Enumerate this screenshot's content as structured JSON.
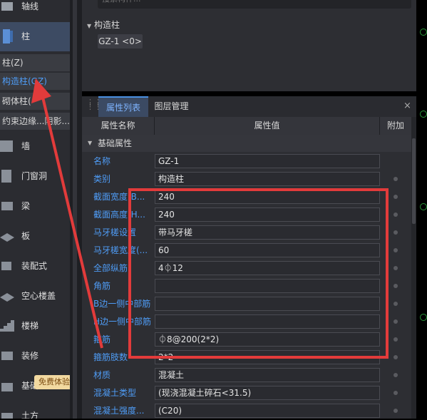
{
  "sidebar": {
    "items": [
      {
        "label": "轴线",
        "icon": "grid-axis-icon"
      },
      {
        "label": "柱",
        "icon": "column-icon",
        "active": true
      },
      {
        "label": "墙",
        "icon": "wall-icon"
      },
      {
        "label": "门窗洞",
        "icon": "door-window-icon"
      },
      {
        "label": "梁",
        "icon": "beam-icon"
      },
      {
        "label": "板",
        "icon": "slab-icon"
      },
      {
        "label": "装配式",
        "icon": "prefab-icon"
      },
      {
        "label": "空心楼盖",
        "icon": "hollow-floor-icon"
      },
      {
        "label": "楼梯",
        "icon": "stair-icon"
      },
      {
        "label": "装修",
        "icon": "decoration-icon"
      },
      {
        "label": "基础",
        "icon": "foundation-icon"
      },
      {
        "label": "土方",
        "icon": "earthwork-icon"
      }
    ],
    "subitems": [
      {
        "label": "柱(Z)"
      },
      {
        "label": "构造柱(GZ)",
        "selected": true
      },
      {
        "label": "砌体柱("
      },
      {
        "label": "约束边缘...阴影..."
      }
    ],
    "badge": "免费体验"
  },
  "top_panel": {
    "search_placeholder": "搜索构件...",
    "tree_label": "构造柱",
    "chip_label": "GZ-1 <0>"
  },
  "bottom_panel": {
    "tabs": [
      {
        "label": "属性列表"
      },
      {
        "label": "图层管理"
      }
    ],
    "close": "×",
    "headers": {
      "name": "属性名称",
      "value": "属性值",
      "extra": "附加"
    },
    "group": "基础属性",
    "rows": [
      {
        "name": "名称",
        "value": "GZ-1"
      },
      {
        "name": "类别",
        "value": "构造柱"
      },
      {
        "name": "截面宽度(B...",
        "value": "240"
      },
      {
        "name": "截面高度(H...",
        "value": "240"
      },
      {
        "name": "马牙槎设置",
        "value": "带马牙槎"
      },
      {
        "name": "马牙槎宽度(...",
        "value": "60"
      },
      {
        "name": "全部纵筋",
        "value": "4⏀12"
      },
      {
        "name": "角筋",
        "value": ""
      },
      {
        "name": "B边一侧中部筋",
        "value": ""
      },
      {
        "name": "H边一侧中部筋",
        "value": ""
      },
      {
        "name": "箍筋",
        "value": "⏀8@200(2*2)"
      },
      {
        "name": "箍筋肢数",
        "value": "2*2"
      },
      {
        "name": "材质",
        "value": "混凝土"
      },
      {
        "name": "混凝土类型",
        "value": "(现浇混凝土碎石<31.5)"
      },
      {
        "name": "混凝土强度...",
        "value": "(C20)"
      }
    ]
  },
  "colors": {
    "accent": "#4f9df7",
    "highlight": "#e23b3b"
  }
}
